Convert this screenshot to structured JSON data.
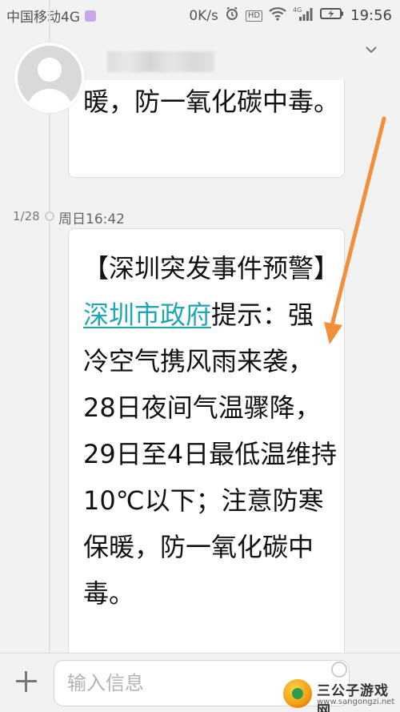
{
  "status_bar": {
    "carrier": "中国移动4G",
    "speed": "0K/s",
    "network_badge": "HD",
    "time": "19:56",
    "icons": [
      "image-notification-icon",
      "alarm-icon",
      "hd-icon",
      "wifi-icon",
      "signal-4g-icon",
      "battery-charging-icon"
    ]
  },
  "header": {
    "contact_name": "1069780795",
    "expand_icon": "chevron-down-icon"
  },
  "messages": {
    "previous_fragment": "暖，防一氧化碳中毒。",
    "divider": {
      "date": "1/28",
      "time": "周日16:42"
    },
    "current": {
      "prefix": "【深圳突发事件预警】",
      "link_text": "深圳市政府",
      "body": "提示：强冷空气携风雨来袭，28日夜间气温骤降，29日至4日最低温维持10℃以下；注意防寒保暖，防一氧化碳中毒。"
    }
  },
  "composer": {
    "placeholder": "输入信息",
    "add_icon": "plus-icon"
  },
  "watermark": {
    "title": "三公子游戏网",
    "url": "www.sangongzi.net"
  },
  "colors": {
    "link": "#1fa6b5",
    "annotation_arrow": "#f0903c",
    "background": "#f2f2f2"
  }
}
